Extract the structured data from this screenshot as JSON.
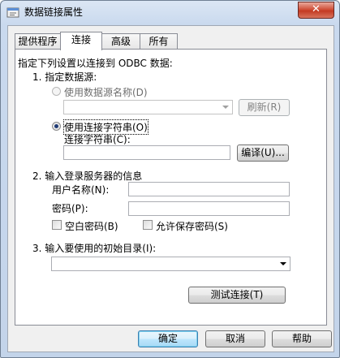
{
  "window": {
    "title": "数据链接属性",
    "close_label": "✕"
  },
  "tabs": [
    {
      "label": "提供程序"
    },
    {
      "label": "连接"
    },
    {
      "label": "高级"
    },
    {
      "label": "所有"
    }
  ],
  "connection": {
    "intro": "指定下列设置以连接到 ODBC 数据:",
    "step1": "1. 指定数据源:",
    "use_dsn_label": "使用数据源名称(D)",
    "refresh_label": "刷新(R)",
    "use_connstr_label": "使用连接字符串(O)",
    "connstr_label": "连接字符串(C):",
    "connstr_value": "",
    "build_label": "编译(U)...",
    "step2": "2. 输入登录服务器的信息",
    "username_label": "用户名称(N):",
    "username_value": "",
    "password_label": "密码(P):",
    "password_value": "",
    "blank_password_label": "空白密码(B)",
    "allow_save_label": "允许保存密码(S)",
    "step3": "3. 输入要使用的初始目录(I):",
    "catalog_value": "",
    "test_label": "测试连接(T)"
  },
  "footer": {
    "ok_label": "确定",
    "cancel_label": "取消",
    "help_label": "帮助"
  }
}
